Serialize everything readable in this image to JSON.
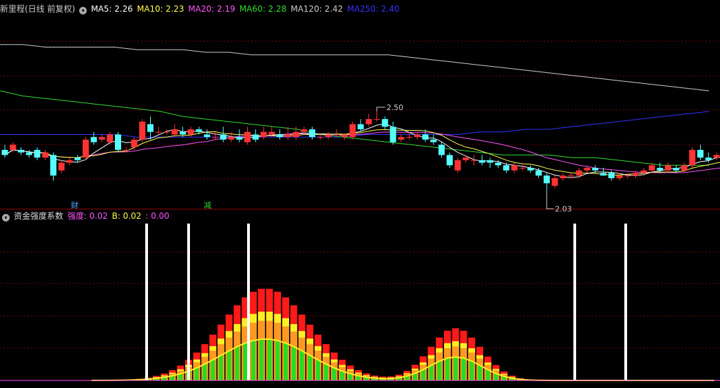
{
  "main_chart": {
    "title": "新里程(日线 前复权)",
    "indicators": [
      {
        "label": "MA5: 2.26",
        "color": "#ffffff"
      },
      {
        "label": "MA10: 2.23",
        "color": "#ffff55"
      },
      {
        "label": "MA20: 2.19",
        "color": "#ff55ff"
      },
      {
        "label": "MA60: 2.28",
        "color": "#33dd33"
      },
      {
        "label": "MA120: 2.42",
        "color": "#cccccc"
      },
      {
        "label": "MA250: 2.40",
        "color": "#3333ff"
      }
    ],
    "high_label": "2.50",
    "low_label": "2.03",
    "markers": [
      "财",
      "减"
    ]
  },
  "sub_chart": {
    "title": "资金强度系数",
    "strength_label": "强度: 0.02",
    "b_label": "B: 0.02",
    "extra_label": ": 0.00"
  },
  "colors": {
    "up": "#ff3333",
    "down": "#55ffff",
    "grid": "#7a0000",
    "divider": "#9a0000"
  },
  "chart_data": {
    "type": "candlestick",
    "candles": [
      [
        2.19,
        2.17,
        2.21,
        2.16
      ],
      [
        2.19,
        2.21,
        2.22,
        2.18
      ],
      [
        2.19,
        2.18,
        2.2,
        2.17
      ],
      [
        2.18,
        2.17,
        2.19,
        2.16
      ],
      [
        2.19,
        2.16,
        2.2,
        2.15
      ],
      [
        2.16,
        2.18,
        2.19,
        2.15
      ],
      [
        2.17,
        2.09,
        2.18,
        2.07
      ],
      [
        2.11,
        2.14,
        2.15,
        2.1
      ],
      [
        2.14,
        2.15,
        2.16,
        2.13
      ],
      [
        2.16,
        2.15,
        2.17,
        2.14
      ],
      [
        2.16,
        2.23,
        2.24,
        2.15
      ],
      [
        2.24,
        2.22,
        2.26,
        2.21
      ],
      [
        2.23,
        2.24,
        2.25,
        2.22
      ],
      [
        2.22,
        2.25,
        2.26,
        2.21
      ],
      [
        2.25,
        2.19,
        2.26,
        2.18
      ],
      [
        2.19,
        2.19,
        2.2,
        2.18
      ],
      [
        2.2,
        2.23,
        2.24,
        2.19
      ],
      [
        2.23,
        2.3,
        2.31,
        2.22
      ],
      [
        2.29,
        2.26,
        2.32,
        2.23
      ],
      [
        2.26,
        2.26,
        2.28,
        2.25
      ],
      [
        2.26,
        2.26,
        2.27,
        2.25
      ],
      [
        2.25,
        2.27,
        2.29,
        2.24
      ],
      [
        2.26,
        2.25,
        2.28,
        2.24
      ],
      [
        2.25,
        2.27,
        2.28,
        2.24
      ],
      [
        2.27,
        2.26,
        2.28,
        2.25
      ],
      [
        2.25,
        2.24,
        2.27,
        2.23
      ],
      [
        2.24,
        2.24,
        2.26,
        2.23
      ],
      [
        2.25,
        2.23,
        2.28,
        2.22
      ],
      [
        2.23,
        2.24,
        2.26,
        2.22
      ],
      [
        2.24,
        2.23,
        2.27,
        2.22
      ],
      [
        2.22,
        2.26,
        2.28,
        2.21
      ],
      [
        2.25,
        2.23,
        2.27,
        2.22
      ],
      [
        2.24,
        2.26,
        2.28,
        2.23
      ],
      [
        2.25,
        2.26,
        2.28,
        2.24
      ],
      [
        2.25,
        2.24,
        2.27,
        2.23
      ],
      [
        2.24,
        2.25,
        2.28,
        2.23
      ],
      [
        2.24,
        2.26,
        2.28,
        2.23
      ],
      [
        2.26,
        2.27,
        2.28,
        2.25
      ],
      [
        2.27,
        2.24,
        2.28,
        2.23
      ],
      [
        2.24,
        2.24,
        2.25,
        2.23
      ],
      [
        2.24,
        2.25,
        2.26,
        2.23
      ],
      [
        2.25,
        2.25,
        2.27,
        2.24
      ],
      [
        2.24,
        2.25,
        2.25,
        2.23
      ],
      [
        2.24,
        2.29,
        2.3,
        2.23
      ],
      [
        2.29,
        2.27,
        2.31,
        2.26
      ],
      [
        2.29,
        2.31,
        2.33,
        2.28
      ],
      [
        2.31,
        2.31,
        2.34,
        2.3
      ],
      [
        2.31,
        2.28,
        2.32,
        2.27
      ],
      [
        2.28,
        2.22,
        2.3,
        2.21
      ],
      [
        2.23,
        2.24,
        2.25,
        2.22
      ],
      [
        2.24,
        2.24,
        2.26,
        2.23
      ],
      [
        2.24,
        2.25,
        2.26,
        2.23
      ],
      [
        2.25,
        2.23,
        2.27,
        2.22
      ],
      [
        2.23,
        2.22,
        2.25,
        2.21
      ],
      [
        2.21,
        2.17,
        2.22,
        2.16
      ],
      [
        2.17,
        2.13,
        2.18,
        2.12
      ],
      [
        2.11,
        2.15,
        2.16,
        2.1
      ],
      [
        2.15,
        2.16,
        2.17,
        2.14
      ],
      [
        2.15,
        2.15,
        2.17,
        2.13
      ],
      [
        2.15,
        2.14,
        2.17,
        2.13
      ],
      [
        2.15,
        2.14,
        2.16,
        2.12
      ],
      [
        2.14,
        2.13,
        2.15,
        2.12
      ],
      [
        2.13,
        2.11,
        2.14,
        2.1
      ],
      [
        2.11,
        2.13,
        2.14,
        2.1
      ],
      [
        2.12,
        2.12,
        2.14,
        2.11
      ],
      [
        2.12,
        2.11,
        2.13,
        2.1
      ],
      [
        2.11,
        2.09,
        2.12,
        2.08
      ],
      [
        2.09,
        2.06,
        2.1,
        2.03
      ],
      [
        2.05,
        2.08,
        2.09,
        2.04
      ],
      [
        2.08,
        2.09,
        2.1,
        2.07
      ],
      [
        2.09,
        2.09,
        2.1,
        2.08
      ],
      [
        2.09,
        2.11,
        2.12,
        2.08
      ],
      [
        2.11,
        2.12,
        2.13,
        2.1
      ],
      [
        2.12,
        2.11,
        2.13,
        2.1
      ],
      [
        2.1,
        2.09,
        2.12,
        2.09
      ],
      [
        2.1,
        2.08,
        2.11,
        2.07
      ],
      [
        2.08,
        2.09,
        2.1,
        2.07
      ],
      [
        2.09,
        2.09,
        2.1,
        2.08
      ],
      [
        2.09,
        2.1,
        2.11,
        2.08
      ],
      [
        2.1,
        2.11,
        2.12,
        2.09
      ],
      [
        2.11,
        2.13,
        2.14,
        2.1
      ],
      [
        2.12,
        2.11,
        2.14,
        2.1
      ],
      [
        2.11,
        2.13,
        2.14,
        2.1
      ],
      [
        2.12,
        2.11,
        2.13,
        2.1
      ],
      [
        2.11,
        2.13,
        2.14,
        2.1
      ],
      [
        2.13,
        2.19,
        2.2,
        2.12
      ],
      [
        2.19,
        2.16,
        2.21,
        2.15
      ],
      [
        2.16,
        2.15,
        2.18,
        2.14
      ],
      [
        2.16,
        2.17,
        2.18,
        2.15
      ],
      [
        2.17,
        2.15,
        2.18,
        2.14
      ]
    ],
    "ma_series": [
      {
        "name": "MA5",
        "color": "#ffffff"
      },
      {
        "name": "MA10",
        "color": "#ffff55"
      },
      {
        "name": "MA20",
        "color": "#ff55ff"
      },
      {
        "name": "MA60",
        "color": "#33dd33"
      },
      {
        "name": "MA120",
        "color": "#cccccc"
      },
      {
        "name": "MA250",
        "color": "#3333ff"
      }
    ],
    "long_ma": {
      "MA60": [
        2.42,
        2.4,
        2.39,
        2.38,
        2.37,
        2.36,
        2.35,
        2.34,
        2.32,
        2.31,
        2.3,
        2.29,
        2.28,
        2.27,
        2.25,
        2.24,
        2.23,
        2.22,
        2.21,
        2.2,
        2.19,
        2.18,
        2.17,
        2.17,
        2.17,
        2.16,
        2.16,
        2.15,
        2.14,
        2.13,
        2.13,
        2.13
      ],
      "MA120": [
        2.6,
        2.6,
        2.59,
        2.59,
        2.59,
        2.59,
        2.58,
        2.58,
        2.58,
        2.57,
        2.57,
        2.56,
        2.56,
        2.56,
        2.56,
        2.56,
        2.56,
        2.56,
        2.55,
        2.54,
        2.53,
        2.52,
        2.51,
        2.5,
        2.49,
        2.48,
        2.47,
        2.46,
        2.45,
        2.44,
        2.43,
        2.42
      ],
      "MA250": [
        2.25,
        2.25,
        2.25,
        2.25,
        2.25,
        2.25,
        2.24,
        2.24,
        2.24,
        2.24,
        2.24,
        2.24,
        2.24,
        2.24,
        2.24,
        2.24,
        2.25,
        2.25,
        2.25,
        2.25,
        2.25,
        2.26,
        2.26,
        2.27,
        2.27,
        2.28,
        2.29,
        2.3,
        2.31,
        2.32,
        2.33,
        2.34
      ]
    },
    "y_range": [
      1.97,
      2.72
    ],
    "sub_series": [
      {
        "name": "强度",
        "color": "#ff55ff"
      },
      {
        "name": "B",
        "color": "#ffff55"
      }
    ],
    "sub_y_range": [
      0,
      1
    ]
  }
}
